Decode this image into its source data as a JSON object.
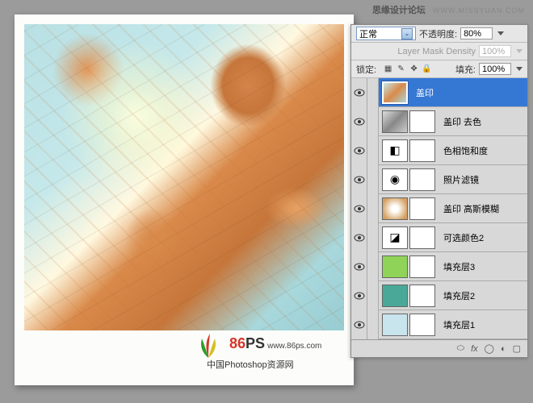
{
  "watermark": {
    "title": "思缘设计论坛",
    "url": "WWW.MISSYUAN.COM"
  },
  "logo": {
    "brand": "86",
    "suffix": "PS",
    "url": "www.86ps.com",
    "subtitle": "中国Photoshop资源网"
  },
  "panel": {
    "blend_mode": "正常",
    "opacity_label": "不透明度:",
    "opacity_value": "80%",
    "mask_label": "Layer Mask Density",
    "mask_value": "100%",
    "lock_label": "锁定:",
    "fill_label": "填充:",
    "fill_value": "100%"
  },
  "layers": [
    {
      "name": "盖印",
      "selected": true,
      "thumb": "photo"
    },
    {
      "name": "盖印 去色",
      "thumb": "gray",
      "mask": true
    },
    {
      "name": "色相饱和度",
      "thumb": "adj-hue",
      "mask": true
    },
    {
      "name": "照片滤镜",
      "thumb": "adj-filter",
      "mask": true
    },
    {
      "name": "盖印 高斯模糊",
      "thumb": "blur",
      "mask": true
    },
    {
      "name": "可选颜色2",
      "thumb": "adj-sel",
      "mask": true
    },
    {
      "name": "填充层3",
      "thumb": "green",
      "mask": true
    },
    {
      "name": "填充层2",
      "thumb": "teal",
      "mask": true
    },
    {
      "name": "填充层1",
      "thumb": "ltblue",
      "mask": true
    }
  ],
  "icons": {
    "link": "⬤",
    "fx": "fx",
    "mask": "▢",
    "adj": "◐",
    "folder": "▣",
    "new": "▦",
    "trash": "🗑"
  }
}
